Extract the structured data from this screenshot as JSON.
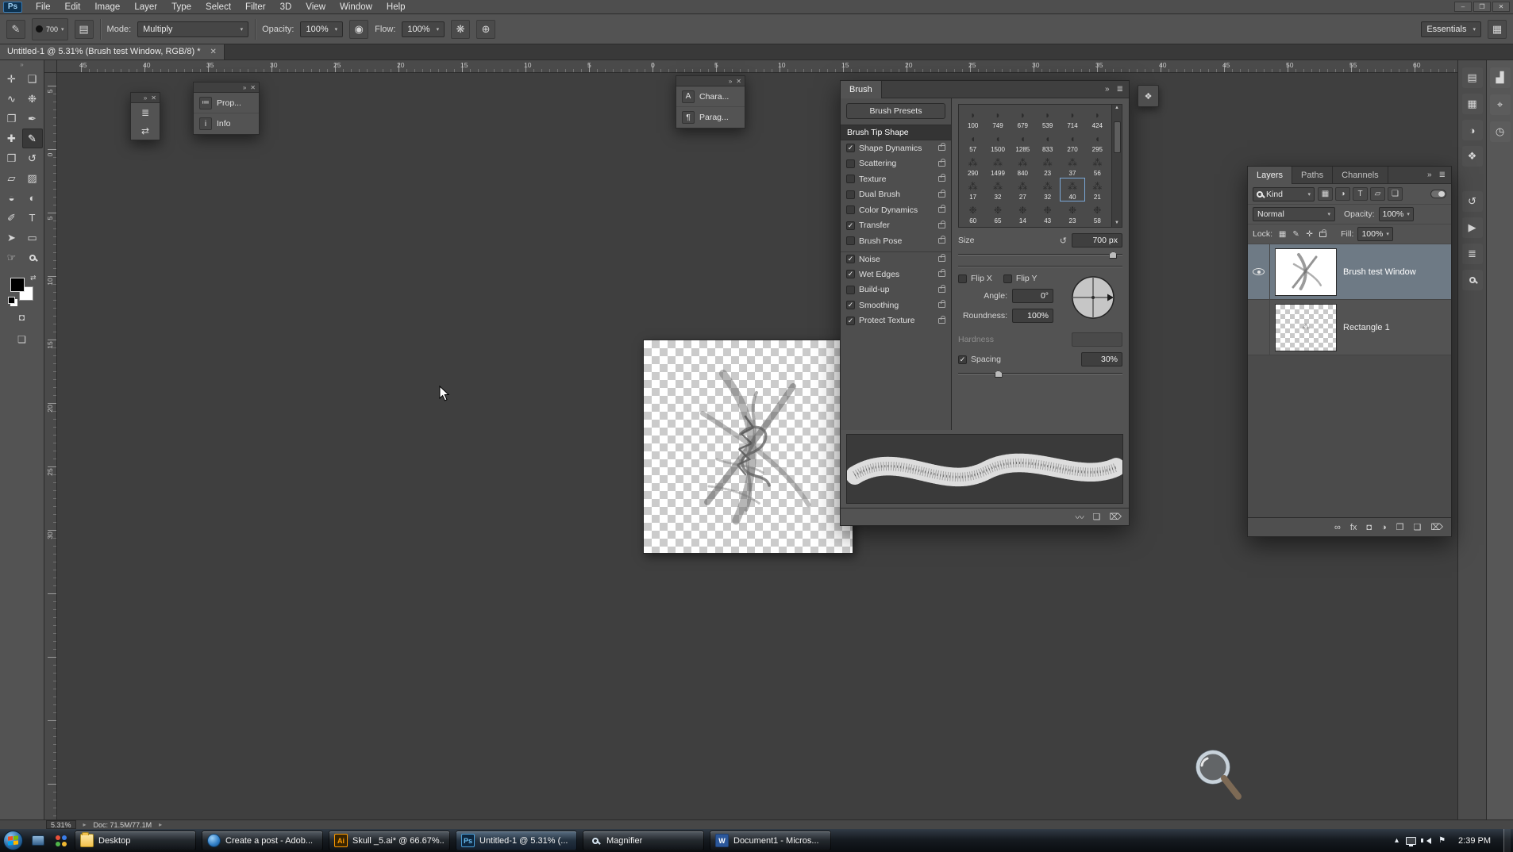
{
  "colors": {
    "app_bg": "#535353",
    "canvas_bg": "#3f3f3f",
    "selected_layer_bg": "#6e7a85",
    "taskbar_bg": "#14181d",
    "tip_selection_outline": "#7aa7d6"
  },
  "window": {
    "controls": [
      {
        "name": "minimize-button",
        "glyph": "–"
      },
      {
        "name": "restore-button",
        "glyph": "❐"
      },
      {
        "name": "close-button",
        "glyph": "✕"
      }
    ]
  },
  "menu": {
    "logo": "Ps",
    "items": [
      "File",
      "Edit",
      "Image",
      "Layer",
      "Type",
      "Select",
      "Filter",
      "3D",
      "View",
      "Window",
      "Help"
    ]
  },
  "options_bar": {
    "tool_glyph": "✎",
    "brush_preset_size": "700",
    "mode_label": "Mode:",
    "mode_value": "Multiply",
    "opacity_label": "Opacity:",
    "opacity_value": "100%",
    "flow_label": "Flow:",
    "flow_value": "100%",
    "workspace_value": "Essentials"
  },
  "doc_tab": {
    "title": "Untitled-1 @ 5.31% (Brush test Window, RGB/8) *",
    "close_glyph": "✕"
  },
  "rulers": {
    "horizontal": [
      "45",
      "40",
      "35",
      "30",
      "25",
      "20",
      "15",
      "10",
      "5",
      "0",
      "5",
      "10",
      "15",
      "20",
      "25",
      "30",
      "35",
      "40",
      "45",
      "50",
      "55",
      "60"
    ],
    "vertical": [
      "5",
      "0",
      "5",
      "10",
      "15",
      "20",
      "25",
      "30"
    ]
  },
  "toolbar": {
    "tools": [
      {
        "name": "move-tool",
        "glyph": "✛"
      },
      {
        "name": "marquee-tool",
        "glyph": "❑"
      },
      {
        "name": "lasso-tool",
        "glyph": "∿"
      },
      {
        "name": "quick-selection-tool",
        "glyph": "❉"
      },
      {
        "name": "crop-tool",
        "glyph": "❐"
      },
      {
        "name": "eyedropper-tool",
        "glyph": "✒"
      },
      {
        "name": "healing-brush-tool",
        "glyph": "✚"
      },
      {
        "name": "brush-tool",
        "glyph": "✎",
        "selected": true
      },
      {
        "name": "clone-stamp-tool",
        "glyph": "❒"
      },
      {
        "name": "history-brush-tool",
        "glyph": "↺"
      },
      {
        "name": "eraser-tool",
        "glyph": "▱"
      },
      {
        "name": "gradient-tool",
        "glyph": "▨"
      },
      {
        "name": "blur-tool",
        "glyph": "◒"
      },
      {
        "name": "dodge-tool",
        "glyph": "◐"
      },
      {
        "name": "pen-tool",
        "glyph": "✐"
      },
      {
        "name": "type-tool",
        "glyph": "T"
      },
      {
        "name": "path-selection-tool",
        "glyph": "➤"
      },
      {
        "name": "shape-tool",
        "glyph": "▭"
      },
      {
        "name": "hand-tool",
        "glyph": "☞"
      },
      {
        "name": "zoom-tool",
        "glyph": "mag"
      }
    ]
  },
  "floating_panels": {
    "mini": {
      "icons": [
        {
          "name": "collapsed-panel-icon-1",
          "glyph": "≣"
        },
        {
          "name": "collapsed-panel-icon-2",
          "glyph": "⇄"
        }
      ]
    },
    "properties_dock": {
      "items": [
        {
          "name": "properties-panel-button",
          "icon": "≔",
          "label": "Prop..."
        },
        {
          "name": "info-panel-button",
          "icon": "i",
          "label": "Info"
        }
      ]
    },
    "character_dock": {
      "items": [
        {
          "name": "character-panel-button",
          "icon": "A",
          "label": "Chara..."
        },
        {
          "name": "paragraph-panel-button",
          "icon": "¶",
          "label": "Parag..."
        }
      ]
    },
    "tool_presets_button_glyph": "❖"
  },
  "brush_panel": {
    "title": "Brush",
    "presets_button": "Brush Presets",
    "tip_shape_label": "Brush Tip Shape",
    "options": [
      {
        "label": "Shape Dynamics",
        "checked": true
      },
      {
        "label": "Scattering",
        "checked": false
      },
      {
        "label": "Texture",
        "checked": false
      },
      {
        "label": "Dual Brush",
        "checked": false
      },
      {
        "label": "Color Dynamics",
        "checked": false
      },
      {
        "label": "Transfer",
        "checked": true
      },
      {
        "label": "Brush Pose",
        "checked": false
      },
      {
        "label": "Noise",
        "checked": true
      },
      {
        "label": "Wet Edges",
        "checked": true
      },
      {
        "label": "Build-up",
        "checked": false
      },
      {
        "label": "Smoothing",
        "checked": true
      },
      {
        "label": "Protect Texture",
        "checked": true
      }
    ],
    "tip_sizes": [
      "100",
      "749",
      "679",
      "539",
      "714",
      "424",
      "57",
      "1500",
      "1285",
      "833",
      "270",
      "295",
      "290",
      "1499",
      "840",
      "23",
      "37",
      "56",
      "17",
      "32",
      "27",
      "32",
      "40",
      "21",
      "60",
      "65",
      "14",
      "43",
      "23",
      "58"
    ],
    "tip_row_glyphs": [
      "◗",
      "◖",
      "⁂",
      "⁂",
      "❉"
    ],
    "selected_tip_index": 22,
    "size_label": "Size",
    "size_value": "700 px",
    "flip_x_label": "Flip X",
    "flip_y_label": "Flip Y",
    "angle_label": "Angle:",
    "angle_value": "0°",
    "roundness_label": "Roundness:",
    "roundness_value": "100%",
    "hardness_label": "Hardness",
    "spacing_label": "Spacing",
    "spacing_value": "30%",
    "foot_icons": [
      {
        "name": "stroke-preview-toggle-icon",
        "glyph": "〰"
      },
      {
        "name": "new-brush-icon",
        "glyph": "❏"
      },
      {
        "name": "delete-brush-icon",
        "glyph": "⌦"
      }
    ]
  },
  "layers_panel": {
    "tabs": [
      {
        "label": "Layers",
        "active": true
      },
      {
        "label": "Paths",
        "active": false
      },
      {
        "label": "Channels",
        "active": false
      }
    ],
    "filter_value": "Kind",
    "filter_icons": [
      {
        "name": "filter-pixel-icon",
        "glyph": "▦"
      },
      {
        "name": "filter-adjustment-icon",
        "glyph": "◑"
      },
      {
        "name": "filter-type-icon",
        "glyph": "T"
      },
      {
        "name": "filter-shape-icon",
        "glyph": "▱"
      },
      {
        "name": "filter-smart-object-icon",
        "glyph": "❏"
      }
    ],
    "blend_value": "Normal",
    "opacity_label": "Opacity:",
    "opacity_value": "100%",
    "lock_label": "Lock:",
    "lock_icons": [
      {
        "name": "lock-transparency-icon",
        "glyph": "▦"
      },
      {
        "name": "lock-pixels-icon",
        "glyph": "✎"
      },
      {
        "name": "lock-position-icon",
        "glyph": "✛"
      },
      {
        "name": "lock-all-icon",
        "glyph": ""
      }
    ],
    "fill_label": "Fill:",
    "fill_value": "100%",
    "layers": [
      {
        "name": "Brush test Window",
        "visible": true,
        "selected": true,
        "thumb": "artwork"
      },
      {
        "name": "Rectangle 1",
        "visible": false,
        "selected": false,
        "thumb": "checker"
      }
    ],
    "foot_icons": [
      {
        "name": "link-layers-icon",
        "glyph": "∞"
      },
      {
        "name": "layer-effects-icon",
        "glyph": "fx"
      },
      {
        "name": "layer-mask-icon",
        "glyph": "◘"
      },
      {
        "name": "adjustment-layer-icon",
        "glyph": "◑"
      },
      {
        "name": "layer-group-icon",
        "glyph": "❒"
      },
      {
        "name": "new-layer-icon",
        "glyph": "❏"
      },
      {
        "name": "delete-layer-icon",
        "glyph": "⌦"
      }
    ]
  },
  "right_dock": {
    "strip_a": [
      {
        "name": "color-panel-icon",
        "glyph": "▤"
      },
      {
        "name": "swatches-panel-icon",
        "glyph": "▦"
      },
      {
        "name": "adjustments-panel-icon",
        "glyph": "◑"
      },
      {
        "name": "styles-panel-icon",
        "glyph": "❖"
      },
      {
        "name": "history-panel-icon",
        "glyph": "↺"
      },
      {
        "name": "actions-panel-icon",
        "glyph": "▶"
      },
      {
        "name": "properties-panel-icon",
        "glyph": "≣"
      },
      {
        "name": "navigator-panel-icon",
        "glyph": "mag"
      }
    ],
    "strip_b": [
      {
        "name": "histogram-panel-icon",
        "glyph": "▟"
      },
      {
        "name": "info-dock-icon",
        "glyph": "⌖"
      },
      {
        "name": "clone-source-panel-icon",
        "glyph": "◷"
      }
    ]
  },
  "status_bar": {
    "zoom": "5.31%",
    "doc_sizes": "Doc: 71.5M/77.1M"
  },
  "taskbar": {
    "pinned": [
      {
        "name": "pinned-app-icon-1",
        "kind": "p1"
      },
      {
        "name": "pinned-app-icon-2",
        "kind": "p2"
      }
    ],
    "buttons": [
      {
        "label": "Desktop",
        "icon": "folder"
      },
      {
        "label": "Create a post - Adob...",
        "icon": "globe"
      },
      {
        "label": "Skull _5.ai* @ 66.67%...",
        "icon": "ai",
        "icon_text": "Ai"
      },
      {
        "label": "Untitled-1 @ 5.31% (...",
        "icon": "ps",
        "icon_text": "Ps",
        "active": true
      },
      {
        "label": "Magnifier",
        "icon": "lens"
      },
      {
        "label": "Document1 - Micros...",
        "icon": "word",
        "icon_text": "W"
      }
    ],
    "tray": [
      {
        "name": "hidden-icons-button",
        "glyph": "▴"
      },
      {
        "name": "network-icon",
        "glyph": "net"
      },
      {
        "name": "volume-icon",
        "glyph": "vol"
      },
      {
        "name": "action-center-icon",
        "glyph": "⚑"
      }
    ],
    "clock": "2:39 PM"
  }
}
